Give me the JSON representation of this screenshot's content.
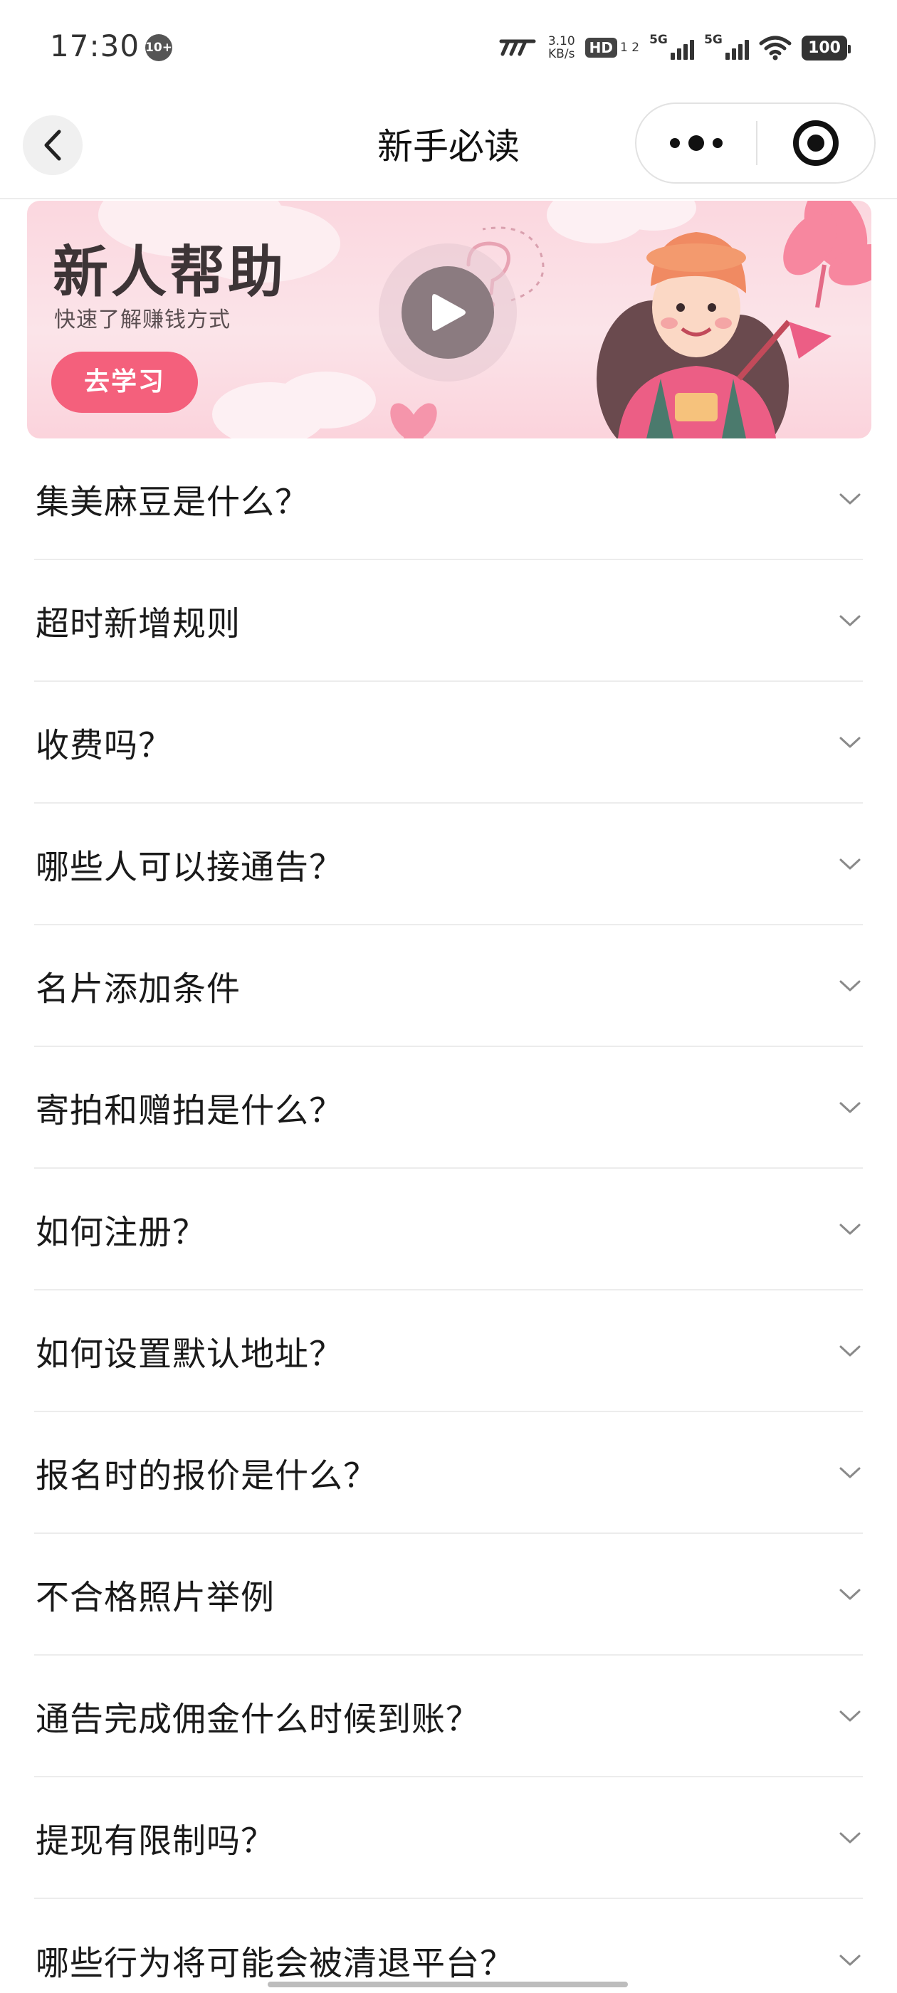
{
  "status_bar": {
    "time": "17:30",
    "notification_badge": "10+",
    "net_speed_value": "3.10",
    "net_speed_unit": "KB/s",
    "hd_label": "HD",
    "hd_sub": "1 2",
    "sim1_label": "5G",
    "sim2_label": "5G",
    "battery": "100",
    "icons": [
      "network-speed-icon",
      "hd-voice-icon",
      "signal-icon",
      "signal-icon",
      "wifi-icon",
      "battery-icon"
    ]
  },
  "nav": {
    "title": "新手必读",
    "back_icon": "chevron-left-icon",
    "more_icon": "more-dots-icon",
    "close_icon": "target-close-icon"
  },
  "banner": {
    "title": "新人帮助",
    "subtitle": "快速了解赚钱方式",
    "button_label": "去学习",
    "play_icon": "play-icon",
    "accent_color": "#f4607c",
    "background_color": "#fbdde3"
  },
  "faq": {
    "chevron_icon": "chevron-down-icon",
    "items": [
      {
        "question": "集美麻豆是什么？"
      },
      {
        "question": "超时新增规则"
      },
      {
        "question": "收费吗？"
      },
      {
        "question": "哪些人可以接通告？"
      },
      {
        "question": "名片添加条件"
      },
      {
        "question": "寄拍和赠拍是什么？"
      },
      {
        "question": "如何注册？"
      },
      {
        "question": "如何设置默认地址？"
      },
      {
        "question": "报名时的报价是什么？"
      },
      {
        "question": "不合格照片举例"
      },
      {
        "question": "通告完成佣金什么时候到账？"
      },
      {
        "question": "提现有限制吗？"
      },
      {
        "question": "哪些行为将可能会被清退平台？"
      }
    ]
  }
}
